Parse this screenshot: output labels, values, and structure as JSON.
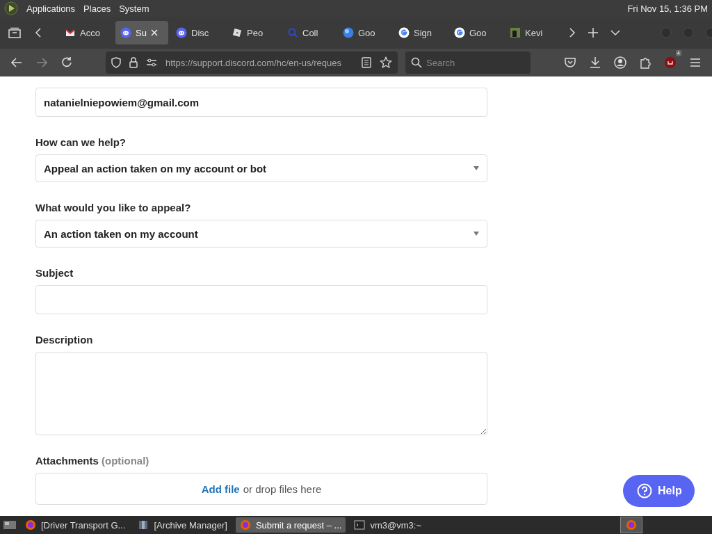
{
  "top_panel": {
    "menus": [
      "Applications",
      "Places",
      "System"
    ],
    "clock": "Fri Nov 15, 1:36 PM"
  },
  "browser": {
    "tabs": [
      {
        "title": "Acco",
        "kind": "mail",
        "selected": false
      },
      {
        "title": "Su",
        "kind": "chat",
        "selected": true
      },
      {
        "title": "Disc",
        "kind": "chat",
        "selected": false
      },
      {
        "title": "Peo",
        "kind": "cube",
        "selected": false
      },
      {
        "title": "Coll",
        "kind": "magnifier",
        "selected": false
      },
      {
        "title": "Goo",
        "kind": "globe",
        "selected": false
      },
      {
        "title": "Sign",
        "kind": "letter",
        "selected": false
      },
      {
        "title": "Goo",
        "kind": "letter",
        "selected": false
      },
      {
        "title": "Kevi",
        "kind": "photo",
        "selected": false
      }
    ],
    "url": "https://support.discord.com/hc/en-us/reques",
    "search": {
      "placeholder": "Search"
    },
    "extension_badge": "4"
  },
  "form": {
    "fields": [
      {
        "kind": "input",
        "value": "natanielniepowiem@gmail.com"
      },
      {
        "kind": "select",
        "label": "How can we help?",
        "value": "Appeal an action taken on my account or bot"
      },
      {
        "kind": "select",
        "label": "What would you like to appeal?",
        "value": "An action taken on my account"
      },
      {
        "kind": "input",
        "label": "Subject"
      },
      {
        "kind": "textarea",
        "label": "Description"
      },
      {
        "kind": "dropzone",
        "label": "Attachments",
        "note": "(optional)",
        "link": "Add file",
        "text": "or drop files here"
      }
    ]
  },
  "help_button": "Help",
  "taskbar": {
    "items": [
      {
        "label": "[Driver Transport G...",
        "kind": "browser",
        "selected": false
      },
      {
        "label": "[Archive Manager]",
        "kind": "archive",
        "selected": false
      },
      {
        "label": "Submit a request – ...",
        "kind": "browser",
        "selected": true
      },
      {
        "label": "vm3@vm3:~",
        "kind": "terminal",
        "selected": false
      }
    ]
  }
}
